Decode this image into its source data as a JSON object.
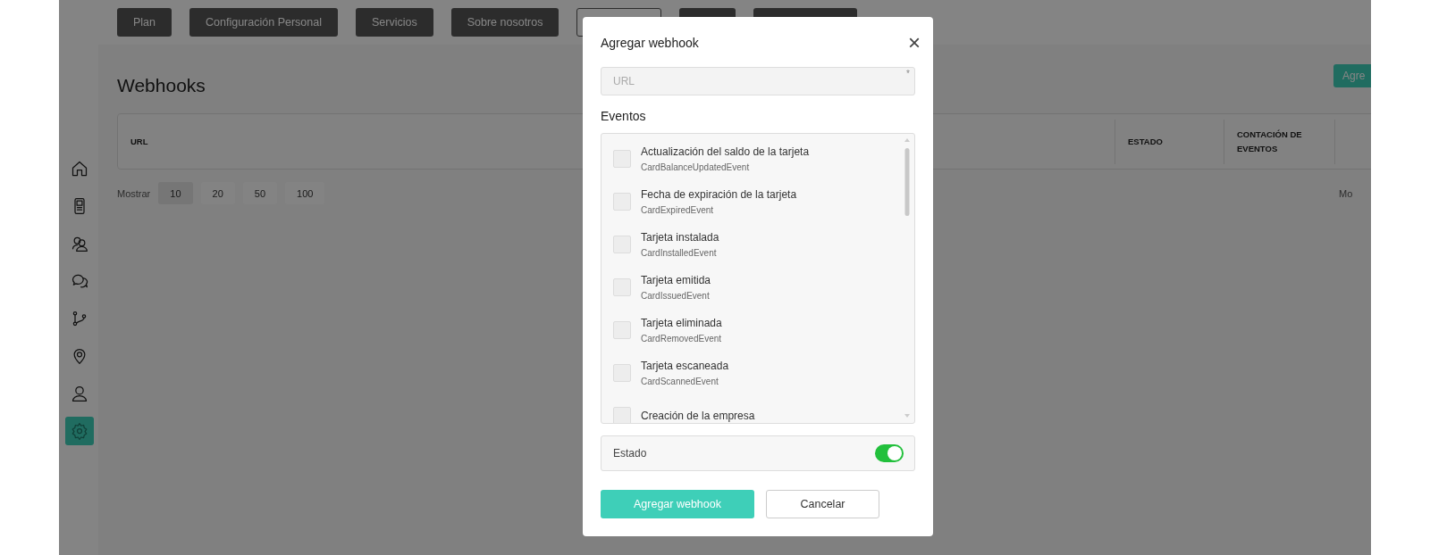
{
  "nav_buttons": [
    {
      "label": "Plan",
      "kind": "dark"
    },
    {
      "label": "Configuración Personal",
      "kind": "dark"
    },
    {
      "label": "Servicios",
      "kind": "dark"
    },
    {
      "label": "Sobre nosotros",
      "kind": "dark"
    },
    {
      "kind": "outline"
    },
    {
      "kind": "dark"
    },
    {
      "kind": "dark"
    }
  ],
  "sidebar": {
    "items": [
      {
        "kind": "home",
        "selected": false
      },
      {
        "kind": "terminal",
        "selected": false
      },
      {
        "kind": "users",
        "selected": false
      },
      {
        "kind": "chat",
        "selected": false
      },
      {
        "kind": "branch",
        "selected": false
      },
      {
        "kind": "pin",
        "selected": false
      },
      {
        "kind": "user",
        "selected": false
      },
      {
        "kind": "gear",
        "selected": true
      }
    ]
  },
  "page": {
    "title": "Webhooks",
    "add_button": "Agre"
  },
  "table": {
    "columns": [
      "URL",
      "ESTADO",
      "CONTACIÓN DE EVENTOS"
    ]
  },
  "pagination": {
    "label": "Mostrar",
    "sizes": [
      {
        "label": "10",
        "selected": true
      },
      {
        "label": "20",
        "selected": false
      },
      {
        "label": "50",
        "selected": false
      },
      {
        "label": "100",
        "selected": false
      }
    ],
    "right_text": "Mo"
  },
  "modal": {
    "title": "Agregar webhook",
    "close": "×",
    "url_field": {
      "placeholder": "URL",
      "required_mark": "*"
    },
    "events_label": "Eventos",
    "events": [
      {
        "title": "Actualización del saldo de la tarjeta",
        "code": "CardBalanceUpdatedEvent",
        "checked": false
      },
      {
        "title": "Fecha de expiración de la tarjeta",
        "code": "CardExpiredEvent",
        "checked": false
      },
      {
        "title": "Tarjeta instalada",
        "code": "CardInstalledEvent",
        "checked": false
      },
      {
        "title": "Tarjeta emitida",
        "code": "CardIssuedEvent",
        "checked": false
      },
      {
        "title": "Tarjeta eliminada",
        "code": "CardRemovedEvent",
        "checked": false
      },
      {
        "title": "Tarjeta escaneada",
        "code": "CardScannedEvent",
        "checked": false
      },
      {
        "title": "Creación de la empresa",
        "checked": false
      }
    ],
    "status": {
      "label": "Estado",
      "on": true
    },
    "buttons": {
      "primary": "Agregar webhook",
      "secondary": "Cancelar"
    }
  }
}
